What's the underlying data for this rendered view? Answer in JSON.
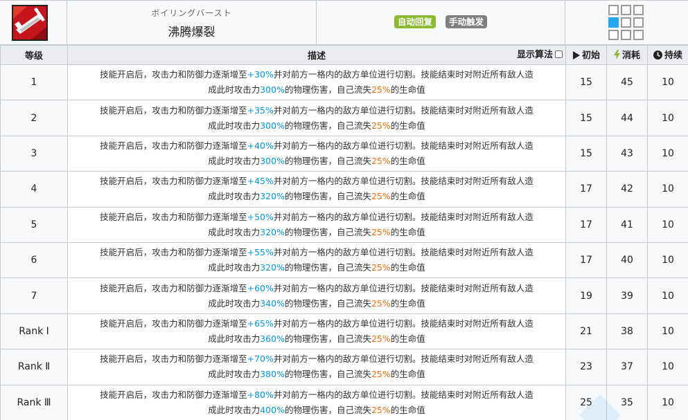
{
  "skill": {
    "name_jp": "ボイリングバースト",
    "name_cn": "沸腾爆裂",
    "tags": {
      "auto": "自动回复",
      "manual": "手动触发"
    },
    "icon": "skill-icon",
    "range_grid": [
      [
        0,
        0,
        0
      ],
      [
        1,
        0,
        0
      ],
      [
        0,
        0,
        0
      ]
    ],
    "colors": {
      "auto_tag": "#8cb832",
      "manual_tag": "#808080",
      "range_active": "#27a6f3",
      "highlight_blue": "#0098dc",
      "highlight_orange": "#ff6a00"
    }
  },
  "table": {
    "headers": {
      "level": "等级",
      "desc": "描述",
      "show_formula": "显示算法",
      "initial": "初始",
      "cost": "消耗",
      "duration": "持续"
    },
    "desc_text": {
      "p1": "技能开启后，攻击力和防御力逐渐增至",
      "p2": "并对前方一格内的敌方单位进行切割。技能结束时对附近所有敌人造",
      "p3": "成此时攻击力",
      "p4": "的物理伤害，自己流失",
      "p5": "的生命值"
    },
    "rows": [
      {
        "level": "1",
        "inc": "+30%",
        "atk": "300%",
        "loss": "25%",
        "initial": "15",
        "cost": "45",
        "duration": "10"
      },
      {
        "level": "2",
        "inc": "+35%",
        "atk": "300%",
        "loss": "25%",
        "initial": "15",
        "cost": "44",
        "duration": "10"
      },
      {
        "level": "3",
        "inc": "+40%",
        "atk": "300%",
        "loss": "25%",
        "initial": "15",
        "cost": "43",
        "duration": "10"
      },
      {
        "level": "4",
        "inc": "+45%",
        "atk": "320%",
        "loss": "25%",
        "initial": "17",
        "cost": "42",
        "duration": "10"
      },
      {
        "level": "5",
        "inc": "+50%",
        "atk": "320%",
        "loss": "25%",
        "initial": "17",
        "cost": "41",
        "duration": "10"
      },
      {
        "level": "6",
        "inc": "+55%",
        "atk": "320%",
        "loss": "25%",
        "initial": "17",
        "cost": "40",
        "duration": "10"
      },
      {
        "level": "7",
        "inc": "+60%",
        "atk": "340%",
        "loss": "25%",
        "initial": "19",
        "cost": "39",
        "duration": "10"
      },
      {
        "level": "Rank Ⅰ",
        "inc": "+65%",
        "atk": "360%",
        "loss": "25%",
        "initial": "21",
        "cost": "38",
        "duration": "10"
      },
      {
        "level": "Rank Ⅱ",
        "inc": "+70%",
        "atk": "380%",
        "loss": "25%",
        "initial": "23",
        "cost": "37",
        "duration": "10"
      },
      {
        "level": "Rank Ⅲ",
        "inc": "+80%",
        "atk": "400%",
        "loss": "25%",
        "initial": "25",
        "cost": "35",
        "duration": "10"
      }
    ]
  }
}
